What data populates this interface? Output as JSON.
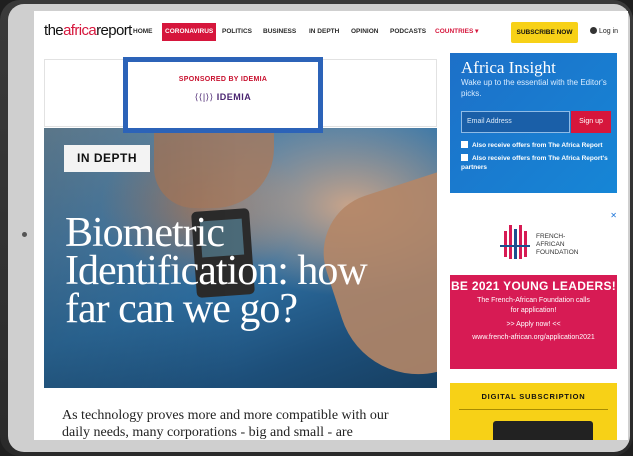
{
  "nav": {
    "logo_a": "the",
    "logo_b": "africa",
    "logo_c": "report",
    "items": [
      {
        "label": "HOME"
      },
      {
        "label": "CORONAVIRUS"
      },
      {
        "label": "POLITICS"
      },
      {
        "label": "BUSINESS"
      },
      {
        "label": "IN DEPTH"
      },
      {
        "label": "OPINION"
      },
      {
        "label": "PODCASTS"
      },
      {
        "label": "COUNTRIES ▾"
      }
    ],
    "subscribe": "SUBSCRIBE NOW",
    "login": "Log in"
  },
  "sponsor": {
    "label": "SPONSORED BY IDEMIA",
    "logo_mark": "⟨⟨|⟩⟩",
    "logo_text": "IDEMIA"
  },
  "hero": {
    "badge": "IN DEPTH",
    "title": "Biometric Identification: how far can we go?"
  },
  "teaser": "As technology proves more and more compatible with our daily needs, many corporations - big and small - are",
  "insight": {
    "title": "Africa Insight",
    "subtitle": "Wake up to the essential with the Editor's picks.",
    "email_placeholder": "Email Address",
    "signup": "Sign up",
    "opt1": "Also receive offers from The Africa Report",
    "opt2": "Also receive offers from The Africa Report's partners"
  },
  "ad": {
    "close": "✕",
    "org": "FRENCH-\nAFRICAN\nFOUNDATION",
    "headline": "BE 2021 YOUNG LEADERS!",
    "line1": "The French-African Foundation calls",
    "line2": "for application!",
    "line3": ">> Apply now! <<",
    "url": "www.french-african.org/application2021"
  },
  "digital": {
    "label": "DIGITAL SUBSCRIPTION"
  }
}
